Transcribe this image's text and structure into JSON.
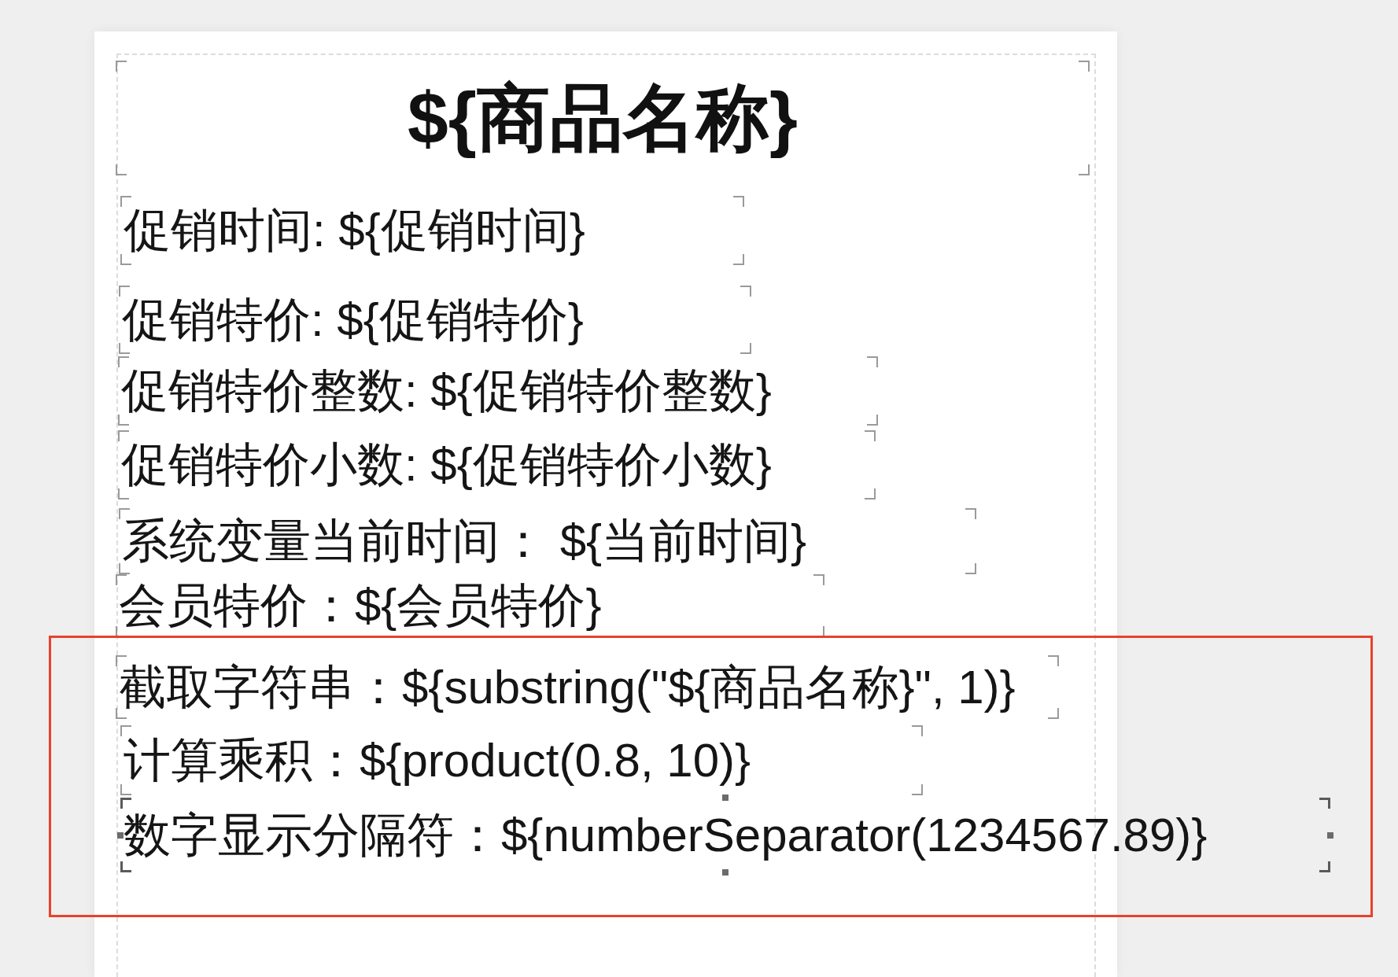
{
  "canvas": {
    "elements": [
      {
        "kind": "title",
        "text": "${商品名称}",
        "selected": false,
        "highlighted": false
      },
      {
        "kind": "text",
        "text": "促销时间: ${促销时间}",
        "selected": false,
        "highlighted": false
      },
      {
        "kind": "text",
        "text": "促销特价: ${促销特价}",
        "selected": false,
        "highlighted": false
      },
      {
        "kind": "text",
        "text": "促销特价整数: ${促销特价整数}",
        "selected": false,
        "highlighted": false
      },
      {
        "kind": "text",
        "text": "促销特价小数: ${促销特价小数}",
        "selected": false,
        "highlighted": false
      },
      {
        "kind": "text",
        "text": "系统变量当前时间： ${当前时间}",
        "selected": false,
        "highlighted": false
      },
      {
        "kind": "text",
        "text": "会员特价：${会员特价}",
        "selected": false,
        "highlighted": false
      },
      {
        "kind": "text",
        "text": "截取字符串：${substring(\"${商品名称}\", 1)}",
        "selected": false,
        "highlighted": true
      },
      {
        "kind": "text",
        "text": "计算乘积：${product(0.8, 10)}",
        "selected": false,
        "highlighted": true
      },
      {
        "kind": "text",
        "text": "数字显示分隔符：${numberSeparator(1234567.89)}",
        "selected": true,
        "highlighted": true
      }
    ]
  }
}
